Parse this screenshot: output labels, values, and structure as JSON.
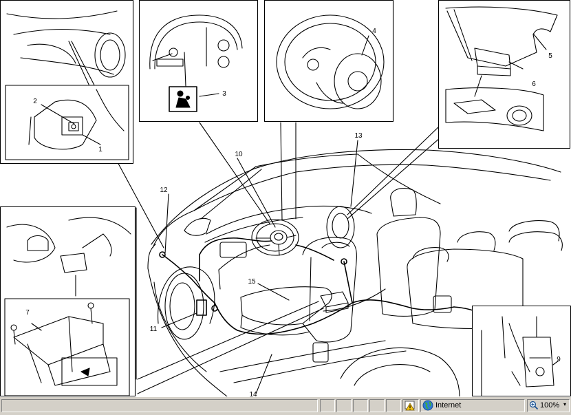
{
  "callouts": [
    {
      "id": "1",
      "text": "1"
    },
    {
      "id": "2",
      "text": "2"
    },
    {
      "id": "3",
      "text": "3"
    },
    {
      "id": "4",
      "text": "4"
    },
    {
      "id": "5",
      "text": "5"
    },
    {
      "id": "6",
      "text": "6"
    },
    {
      "id": "7",
      "text": "7"
    },
    {
      "id": "9",
      "text": "9"
    },
    {
      "id": "10",
      "text": "10"
    },
    {
      "id": "11",
      "text": "11"
    },
    {
      "id": "12",
      "text": "12"
    },
    {
      "id": "13",
      "text": "13"
    },
    {
      "id": "14",
      "text": "14"
    },
    {
      "id": "15",
      "text": "15"
    }
  ],
  "statusbar": {
    "zone_label": "Internet",
    "zone_icon": "globe-icon",
    "warning_icon": "lock-warning-icon",
    "zoom_icon": "magnifier-icon",
    "zoom_label": "100%"
  }
}
